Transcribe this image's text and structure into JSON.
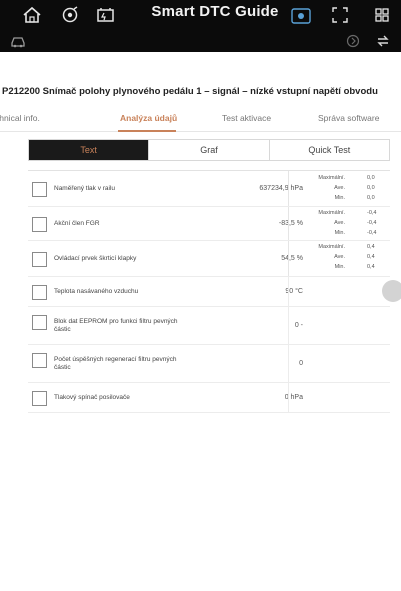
{
  "header": {
    "title": "Smart DTC Guide",
    "icons": [
      "home-icon",
      "vci-icon",
      "car-battery-icon",
      "vin-icon",
      "fullscreen-icon",
      "grid-icon",
      "car-icon",
      "forward-icon",
      "refresh-icon"
    ]
  },
  "dtc": {
    "title": "P212200 Snímač polohy plynového pedálu 1 – signál – nízké vstupní napětí obvodu"
  },
  "tabs": [
    {
      "label": "Technical info."
    },
    {
      "label": "Analýza údajů"
    },
    {
      "label": "Test aktivace"
    },
    {
      "label": "Správa software"
    }
  ],
  "segments": [
    {
      "label": "Text"
    },
    {
      "label": "Graf"
    },
    {
      "label": "Quick Test"
    }
  ],
  "rows": [
    {
      "name": "Naměřený tlak v railu",
      "value": "637234,9 hPa",
      "stats": [
        {
          "label": "Maximální.",
          "value": "0,0"
        },
        {
          "label": "Ave.",
          "value": "0,0"
        },
        {
          "label": "Min.",
          "value": "0,0"
        }
      ]
    },
    {
      "name": "Akční člen FGR",
      "value": "-83,5 %",
      "stats": [
        {
          "label": "Maximální.",
          "value": "-0,4"
        },
        {
          "label": "Ave.",
          "value": "-0,4"
        },
        {
          "label": "Min.",
          "value": "-0,4"
        }
      ]
    },
    {
      "name": "Ovládací prvek škrticí klapky",
      "value": "54,5 %",
      "stats": [
        {
          "label": "Maximální.",
          "value": "0,4"
        },
        {
          "label": "Ave.",
          "value": "0,4"
        },
        {
          "label": "Min.",
          "value": "0,4"
        }
      ]
    },
    {
      "name": "Teplota nasávaného vzduchu",
      "value": "90 °C",
      "stats": []
    },
    {
      "name": "Blok dat EEPROM pro funkci filtru pevných částic",
      "value": "0 -",
      "stats": []
    },
    {
      "name": "Počet úspěšných regenerací filtru pevných částic",
      "value": "0",
      "stats": []
    },
    {
      "name": "Tlakový spínač posilovače",
      "value": "0 hPa",
      "stats": []
    }
  ],
  "colors": {
    "accent": "#c9825a",
    "header_bg": "#0b0b0b",
    "active_segment_bg": "#1a1a1a"
  }
}
